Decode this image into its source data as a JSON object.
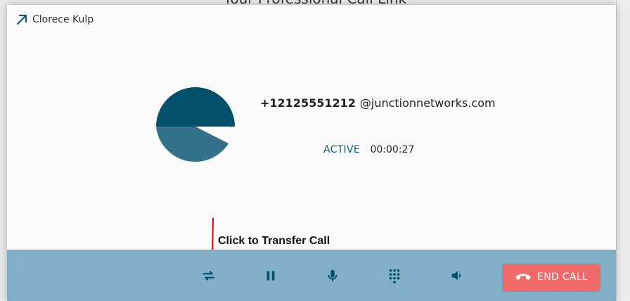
{
  "background": {
    "title": "Your Professional Call Link"
  },
  "header": {
    "contact_name": "Clorece Kulp"
  },
  "call": {
    "number": "+12125551212",
    "domain": "@junctionnetworks.com",
    "status": "ACTIVE",
    "timer": "00:00:27"
  },
  "annotation": {
    "text": "Click to Transfer Call"
  },
  "toolbar": {
    "end_call_label": "END CALL"
  },
  "colors": {
    "toolbar_bg": "#82afc8",
    "accent": "#0d5a7a",
    "avatar_dark": "#02506b",
    "avatar_light": "#33718a",
    "end_call_bg": "#f06a6a",
    "annotation_arrow": "#e60000"
  },
  "icons": {
    "header": "expand-arrow-icon",
    "toolbar": [
      "transfer-icon",
      "pause-icon",
      "microphone-icon",
      "dialpad-icon",
      "speaker-icon",
      "phone-hangup-icon"
    ]
  }
}
